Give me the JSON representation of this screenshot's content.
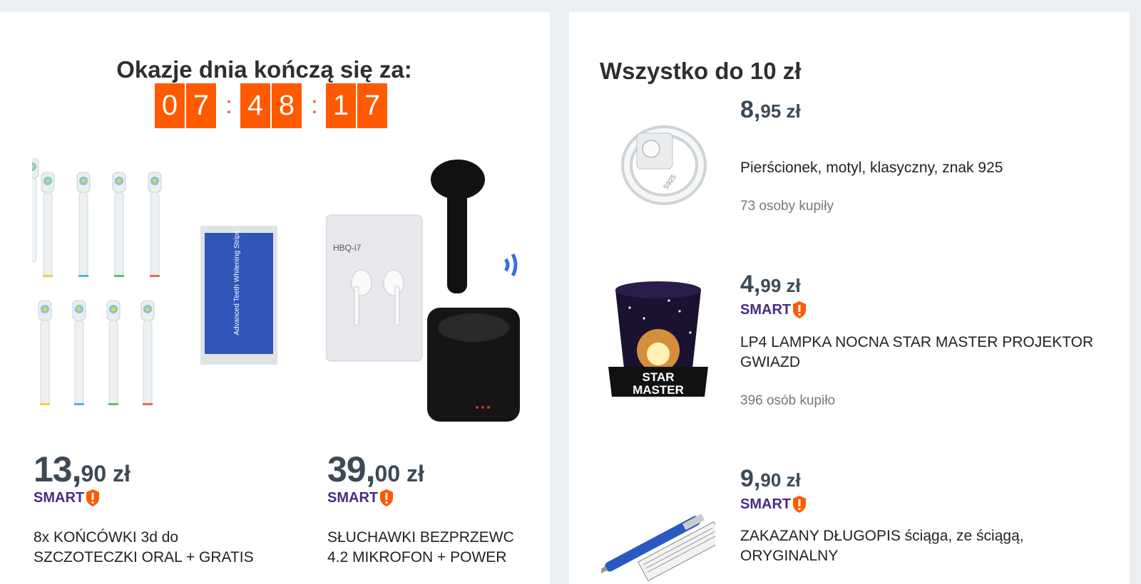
{
  "deals": {
    "title": "Okazje dnia kończą się za:",
    "countdown": {
      "hours": [
        "0",
        "7"
      ],
      "minutes": [
        "4",
        "8"
      ],
      "seconds": [
        "1",
        "7"
      ],
      "separator": ":"
    },
    "items": [
      {
        "price_int": "13,",
        "price_dec": "90 zł",
        "badge": "SMART",
        "name_line1": "8x KOŃCÓWKI 3d do",
        "name_line2": "SZCZOTECZKI ORAL + GRATIS"
      },
      {
        "price_int": "39,",
        "price_dec": "00 zł",
        "badge": "SMART",
        "name_line1": "SŁUCHAWKI BEZPRZEWC",
        "name_line2": "4.2 MIKROFON + POWER"
      }
    ]
  },
  "cheap": {
    "title": "Wszystko do 10 zł",
    "items": [
      {
        "price_int": "8,",
        "price_dec": "95 zł",
        "badge": "",
        "name": "Pierścionek, motyl, klasyczny, znak 925",
        "bought": "73 osoby kupiły",
        "image_label": "S925"
      },
      {
        "price_int": "4,",
        "price_dec": "99 zł",
        "badge": "SMART",
        "name": "LP4 LAMPKA NOCNA STAR MASTER PROJEKTOR GWIAZD",
        "bought": "396 osób kupiło",
        "image_label_1": "STAR",
        "image_label_2": "MASTER"
      },
      {
        "price_int": "9,",
        "price_dec": "90 zł",
        "badge": "SMART",
        "name": "ZAKAZANY DŁUGOPIS ściąga, ze ściągą, ORYGINALNY",
        "bought": ""
      }
    ]
  },
  "image_texts": {
    "box_brand": "HBQ-i7",
    "strips_text": "Advanced Teeth Whitening Strips"
  },
  "colors": {
    "accent": "#ff5a00",
    "smart_purple": "#4b2a84",
    "price": "#3d4a56"
  },
  "icons": {
    "smart_badge": "exclamation-shield-icon"
  }
}
